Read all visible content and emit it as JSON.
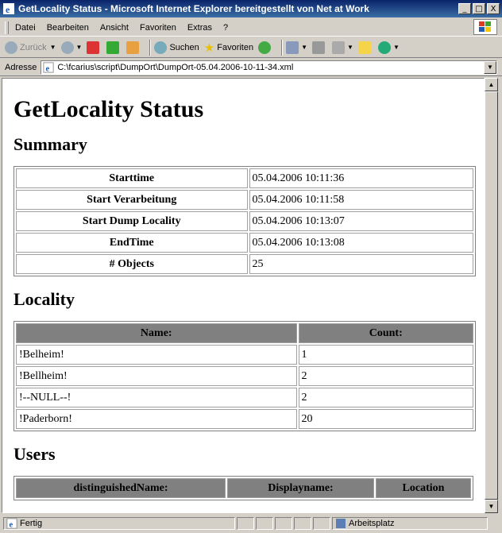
{
  "window": {
    "title": "GetLocality Status - Microsoft Internet Explorer bereitgestellt von Net at Work",
    "buttons": {
      "minimize": "_",
      "maximize": "□",
      "close": "X"
    }
  },
  "menu": {
    "items": [
      {
        "label": "Datei"
      },
      {
        "label": "Bearbeiten"
      },
      {
        "label": "Ansicht"
      },
      {
        "label": "Favoriten"
      },
      {
        "label": "Extras"
      },
      {
        "label": "?"
      }
    ]
  },
  "toolbar": {
    "back_label": "Zurück",
    "search_label": "Suchen",
    "favorites_label": "Favoriten"
  },
  "address": {
    "label": "Adresse",
    "value": "C:\\fcarius\\script\\DumpOrt\\DumpOrt-05.04.2006-10-11-34.xml"
  },
  "page": {
    "heading": "GetLocality Status",
    "summary_heading": "Summary",
    "summary": [
      {
        "label": "Starttime",
        "value": "05.04.2006 10:11:36"
      },
      {
        "label": "Start Verarbeitung",
        "value": "05.04.2006 10:11:58"
      },
      {
        "label": "Start Dump Locality",
        "value": "05.04.2006 10:13:07"
      },
      {
        "label": "EndTime",
        "value": "05.04.2006 10:13:08"
      },
      {
        "label": "# Objects",
        "value": "25"
      }
    ],
    "locality_heading": "Locality",
    "locality_columns": {
      "name": "Name:",
      "count": "Count:"
    },
    "locality_rows": [
      {
        "name": "!Belheim!",
        "count": "1"
      },
      {
        "name": "!Bellheim!",
        "count": "2"
      },
      {
        "name": "!--NULL--!",
        "count": "2"
      },
      {
        "name": "!Paderborn!",
        "count": "20"
      }
    ],
    "users_heading": "Users",
    "users_columns": {
      "dn": "distinguishedName:",
      "display": "Displayname:",
      "location": "Location"
    }
  },
  "status": {
    "text": "Fertig",
    "zone": "Arbeitsplatz"
  },
  "colors": {
    "titlebar_start": "#0a246a",
    "titlebar_end": "#3a6ea5",
    "table_header_bg": "#808080"
  }
}
